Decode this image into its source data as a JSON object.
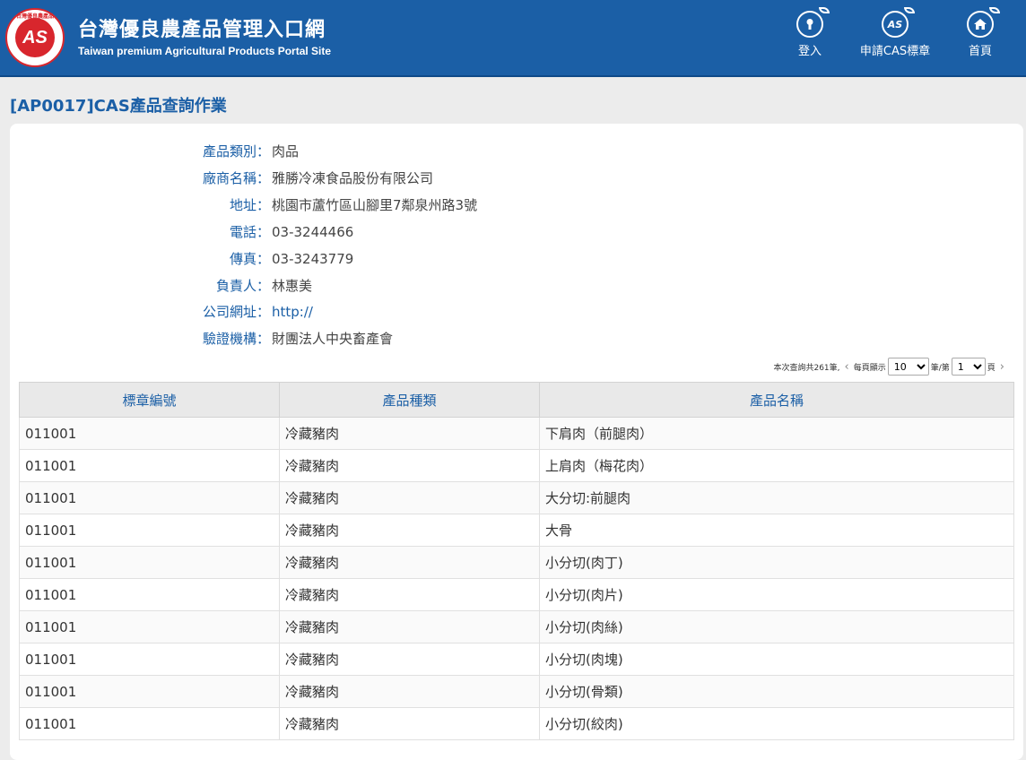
{
  "header": {
    "title_zh": "台灣優良農產品管理入口網",
    "title_en": "Taiwan premium Agricultural Products Portal Site",
    "logo_text": "AS",
    "logo_ring": "台灣優良農產品",
    "nav": [
      {
        "label": "登入",
        "icon": "login-icon"
      },
      {
        "label": "申請CAS標章",
        "icon": "cas-apply-icon"
      },
      {
        "label": "首頁",
        "icon": "home-icon"
      }
    ],
    "colors": {
      "brand": "#1b5fa6",
      "logo_red": "#d8262d"
    }
  },
  "page": {
    "title": "[AP0017]CAS產品查詢作業"
  },
  "info": [
    {
      "label": "產品類別：",
      "value": "肉品"
    },
    {
      "label": "廠商名稱：",
      "value": "雅勝冷凍食品股份有限公司"
    },
    {
      "label": "地址：",
      "value": "桃園市蘆竹區山腳里7鄰泉州路3號"
    },
    {
      "label": "電話：",
      "value": "03-3244466"
    },
    {
      "label": "傳真：",
      "value": "03-3243779"
    },
    {
      "label": "負責人：",
      "value": "林惠美"
    },
    {
      "label": "公司網址：",
      "value": "http://"
    },
    {
      "label": "驗證機構：",
      "value": "財團法人中央畜產會"
    }
  ],
  "pager": {
    "total_text": "本次查詢共261筆,",
    "per_page_label": "每頁顯示",
    "per_page_value": "10",
    "mid_label": "筆/第",
    "page_value": "1",
    "page_suffix": "頁"
  },
  "table": {
    "headers": [
      "標章編號",
      "產品種類",
      "產品名稱"
    ],
    "rows": [
      [
        "011001",
        "冷藏豬肉",
        "下肩肉（前腿肉）"
      ],
      [
        "011001",
        "冷藏豬肉",
        "上肩肉（梅花肉）"
      ],
      [
        "011001",
        "冷藏豬肉",
        "大分切:前腿肉"
      ],
      [
        "011001",
        "冷藏豬肉",
        "大骨"
      ],
      [
        "011001",
        "冷藏豬肉",
        "小分切(肉丁)"
      ],
      [
        "011001",
        "冷藏豬肉",
        "小分切(肉片)"
      ],
      [
        "011001",
        "冷藏豬肉",
        "小分切(肉絲)"
      ],
      [
        "011001",
        "冷藏豬肉",
        "小分切(肉塊)"
      ],
      [
        "011001",
        "冷藏豬肉",
        "小分切(骨類)"
      ],
      [
        "011001",
        "冷藏豬肉",
        "小分切(絞肉)"
      ]
    ]
  }
}
